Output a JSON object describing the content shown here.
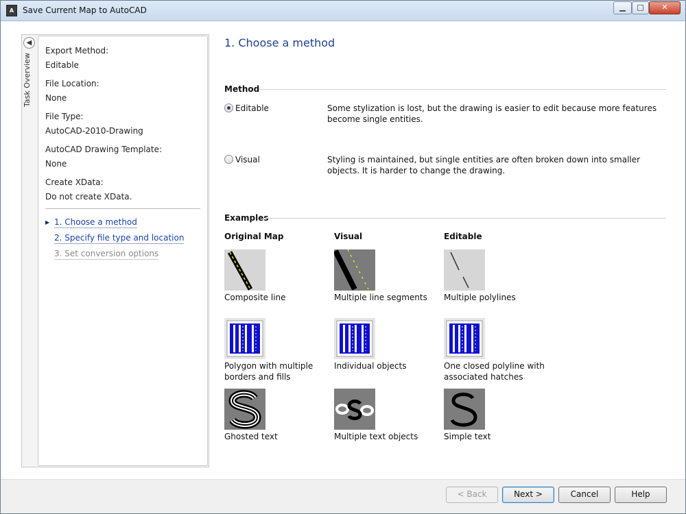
{
  "window": {
    "title": "Save Current Map to AutoCAD",
    "icon": "autocad-map-icon"
  },
  "sidebar": {
    "tab_label": "Task Overview",
    "summary": [
      {
        "label": "Export Method:",
        "value": "Editable"
      },
      {
        "label": "File Location:",
        "value": "None"
      },
      {
        "label": "File Type:",
        "value": "AutoCAD-2010-Drawing"
      },
      {
        "label": "AutoCAD Drawing Template:",
        "value": "None"
      },
      {
        "label": "Create XData:",
        "value": "Do not create XData."
      }
    ],
    "steps": [
      {
        "label": "1. Choose a method",
        "state": "current"
      },
      {
        "label": "2. Specify file type and location",
        "state": "enabled"
      },
      {
        "label": "3. Set conversion options",
        "state": "disabled"
      }
    ]
  },
  "main": {
    "title": "1. Choose a method",
    "method": {
      "heading": "Method",
      "options": [
        {
          "label": "Editable",
          "selected": true,
          "description": "Some stylization is lost, but the drawing is easier to edit because more features become single entities."
        },
        {
          "label": "Visual",
          "selected": false,
          "description": "Styling is maintained, but single entities are often broken down into smaller objects. It is harder to change the drawing."
        }
      ]
    },
    "examples": {
      "heading": "Examples",
      "columns": [
        "Original Map",
        "Visual",
        "Editable"
      ],
      "rows": [
        [
          "Composite line",
          "Multiple line segments",
          "Multiple polylines"
        ],
        [
          "Polygon with multiple borders and fills",
          "Individual objects",
          "One closed polyline with associated hatches"
        ],
        [
          "Ghosted text",
          "Multiple text objects",
          "Simple text"
        ]
      ]
    }
  },
  "footer": {
    "back": "< Back",
    "next": "Next >",
    "cancel": "Cancel",
    "help": "Help"
  },
  "colors": {
    "link": "#1a44a8",
    "title": "#1f3f8f",
    "hatch_blue": "#1010d0"
  }
}
